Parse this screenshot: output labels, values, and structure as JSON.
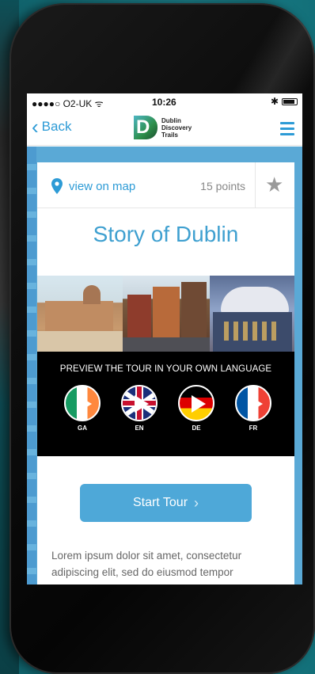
{
  "status_bar": {
    "carrier": "●●●●○ O2-UK ᯤ",
    "time": "10:26",
    "bluetooth": "✱"
  },
  "nav": {
    "back_label": "Back",
    "back_chevron": "‹",
    "logo_letter": "D",
    "logo_lines": [
      "Dublin",
      "Discovery",
      "Trails"
    ]
  },
  "card": {
    "map_link": "view on map",
    "points": "15 points",
    "star": "★",
    "title": "Story of Dublin"
  },
  "preview": {
    "heading": "PREVIEW THE TOUR IN YOUR OWN LANGUAGE",
    "languages": [
      {
        "code": "GA"
      },
      {
        "code": "EN"
      },
      {
        "code": "DE"
      },
      {
        "code": "FR"
      }
    ]
  },
  "start_tour": {
    "label": "Start Tour",
    "arrow": "›"
  },
  "description": "Lorem ipsum dolor sit amet, consectetur adipiscing elit, sed do eiusmod tempor",
  "colors": {
    "accent": "#2d9bd6",
    "title": "#3fa0d0",
    "button": "#4ea8d8",
    "backdrop": "#187781"
  }
}
